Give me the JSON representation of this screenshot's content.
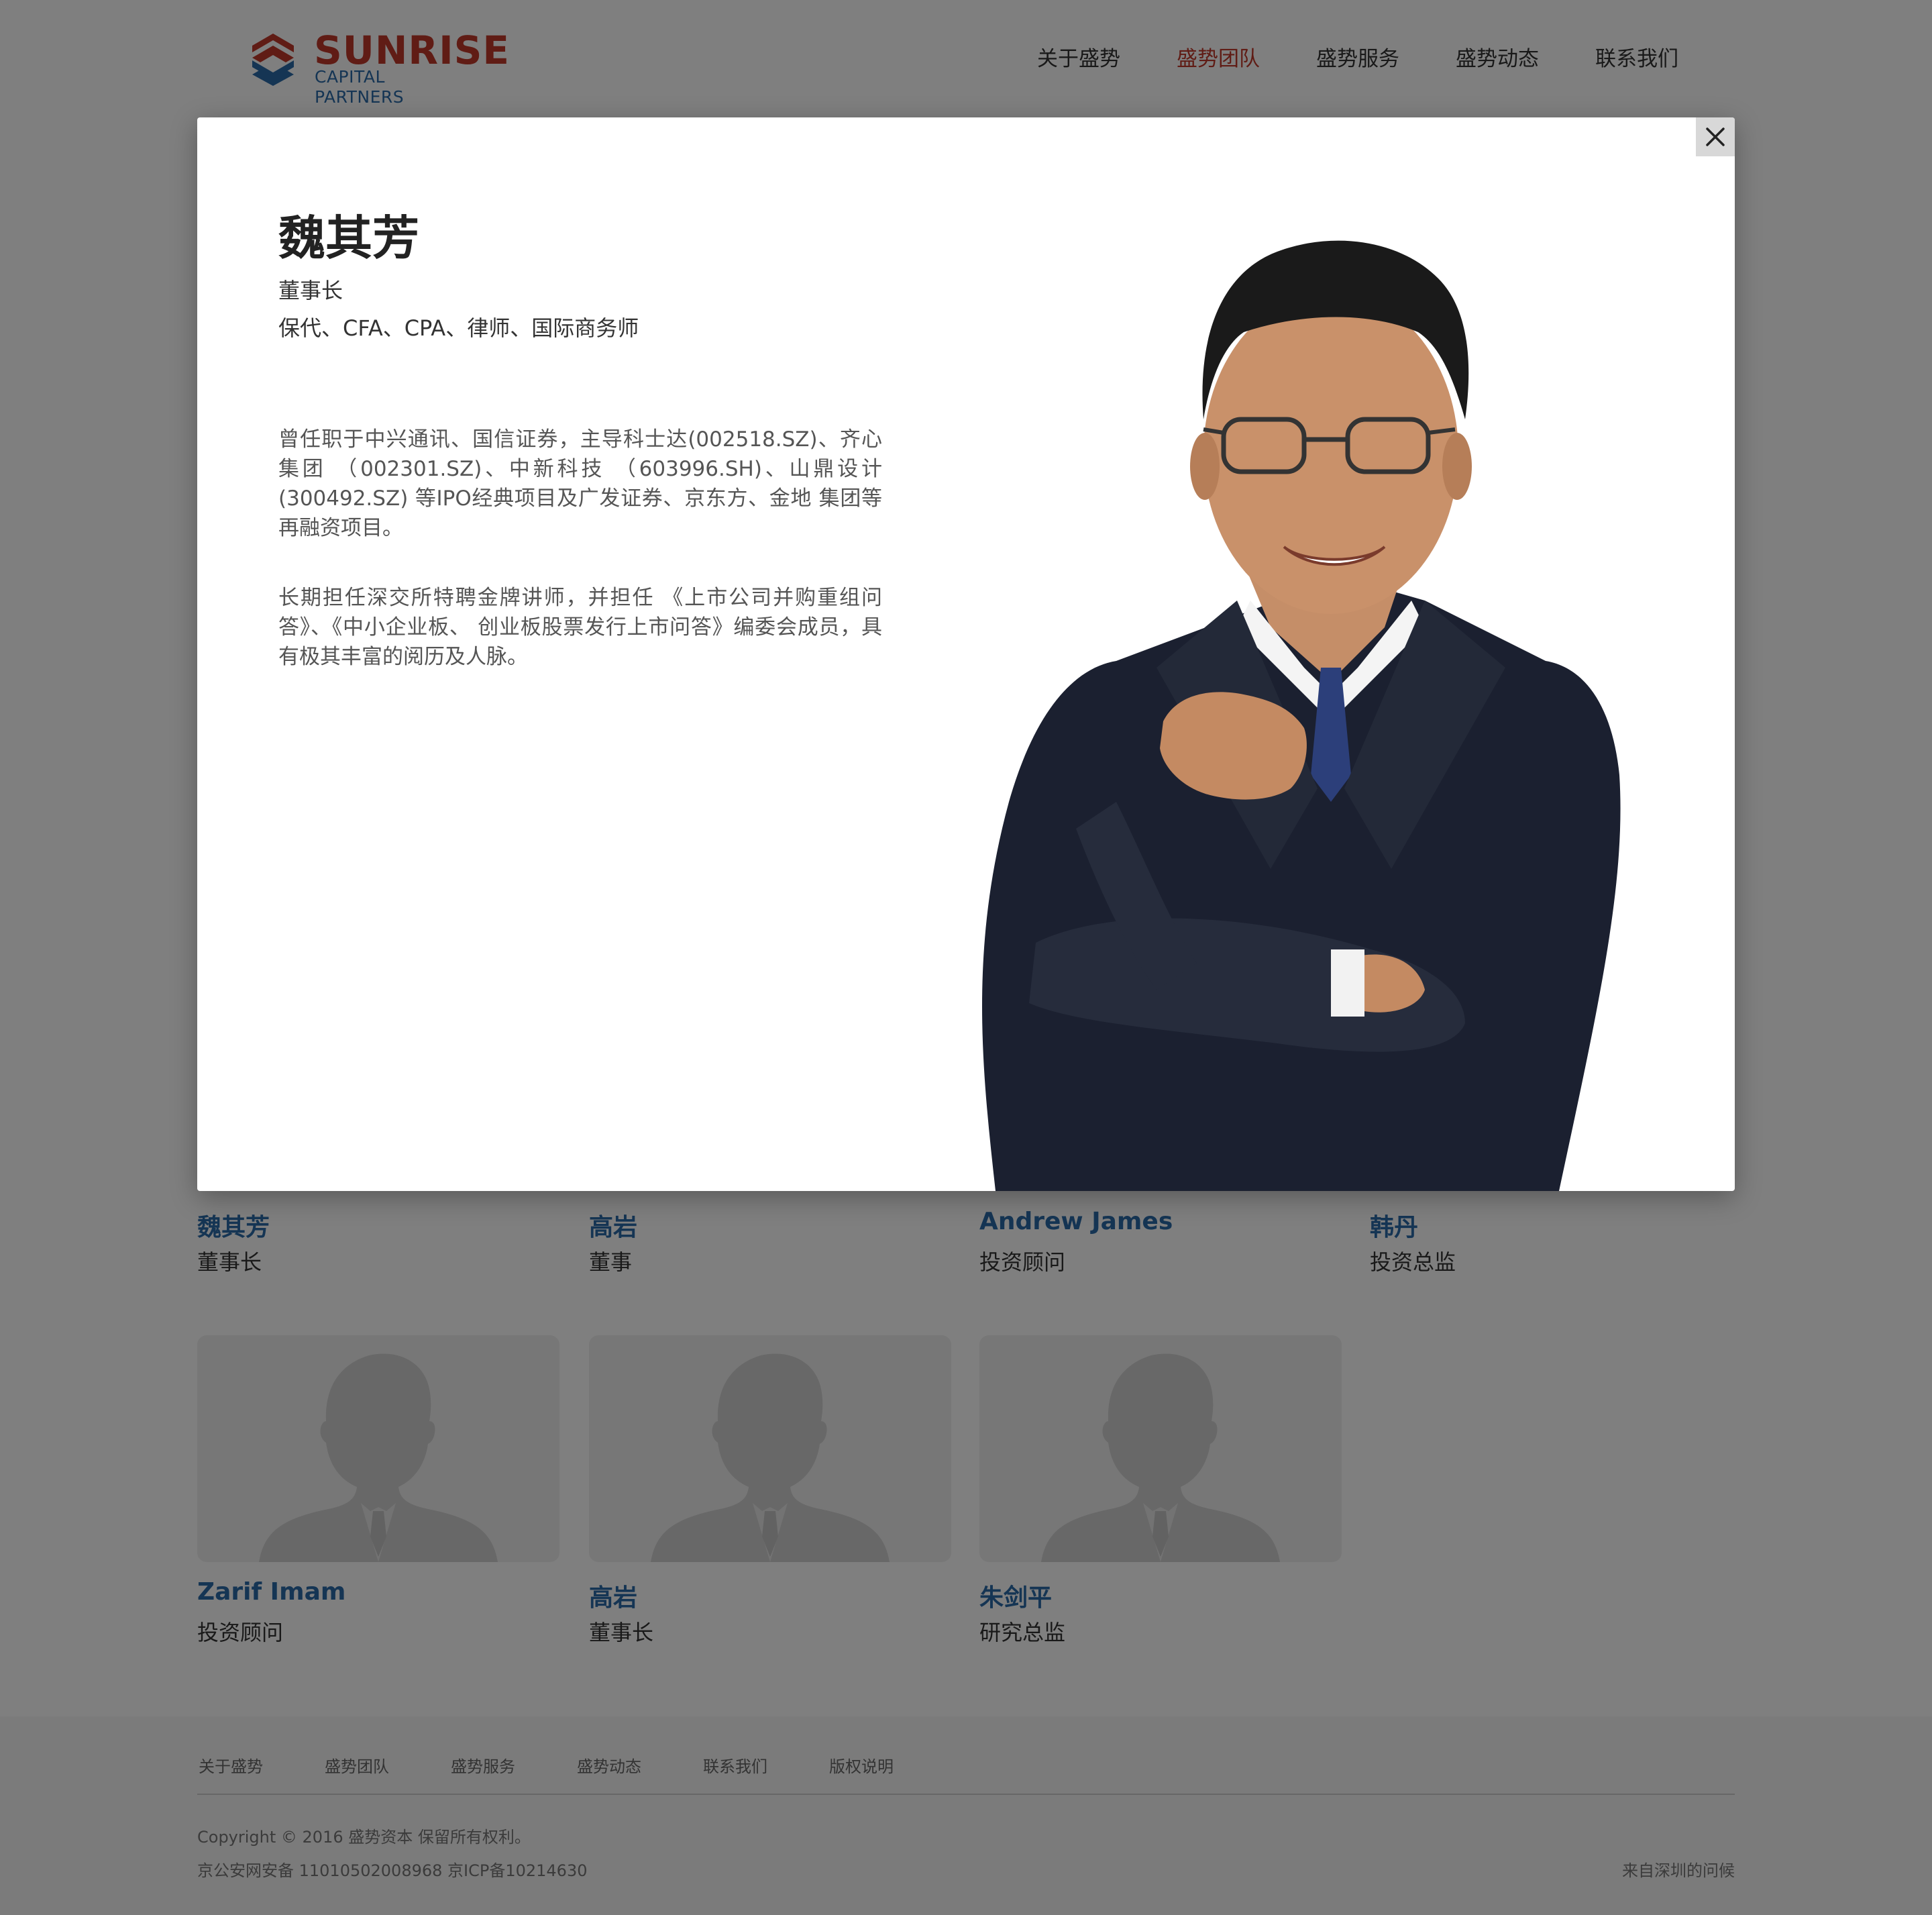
{
  "header": {
    "logo_word": "SUNRISE",
    "logo_sub": "CAPITAL PARTNERS",
    "nav": [
      {
        "label": "关于盛势",
        "active": false
      },
      {
        "label": "盛势团队",
        "active": true
      },
      {
        "label": "盛势服务",
        "active": false
      },
      {
        "label": "盛势动态",
        "active": false
      },
      {
        "label": "联系我们",
        "active": false
      }
    ]
  },
  "team": [
    {
      "name": "魏其芳",
      "role": "董事长"
    },
    {
      "name": "高岩",
      "role": "董事"
    },
    {
      "name": "Andrew James",
      "role": "投资顾问"
    },
    {
      "name": "韩丹",
      "role": "投资总监"
    },
    {
      "name": "Zarif Imam",
      "role": "投资顾问"
    },
    {
      "name": "高岩",
      "role": "董事长"
    },
    {
      "name": "朱剑平",
      "role": "研究总监"
    }
  ],
  "modal": {
    "name": "魏其芳",
    "title": "董事长",
    "credentials": "保代、CFA、CPA、律师、国际商务师",
    "bio_1": "曾任职于中兴通讯、国信证券，主导科士达(002518.SZ)、齐心集团 （002301.SZ)、中新科技 （603996.SH)、山鼎设计(300492.SZ) 等IPO经典项目及广发证券、京东方、金地 集团等再融资项目。",
    "bio_2": "长期担任深交所特聘金牌讲师，并担任 《上市公司并购重组问答》、《中小企业板、 创业板股票发行上市问答》编委会成员，具 有极其丰富的阅历及人脉。"
  },
  "footer": {
    "links": [
      "关于盛势",
      "盛势团队",
      "盛势服务",
      "盛势动态",
      "联系我们",
      "版权说明"
    ],
    "copyright": "Copyright © 2016 盛势资本 保留所有权利。",
    "icp": "京公安网安备 11010502008968 京ICP备10214630",
    "right": "来自深圳的问候"
  },
  "colors": {
    "brand_red": "#c0392b",
    "brand_blue": "#2b6aa8",
    "overlay": "rgba(0,0,0,0.5)"
  },
  "icons": {
    "close": "close-icon",
    "avatar": "person-silhouette-icon"
  }
}
